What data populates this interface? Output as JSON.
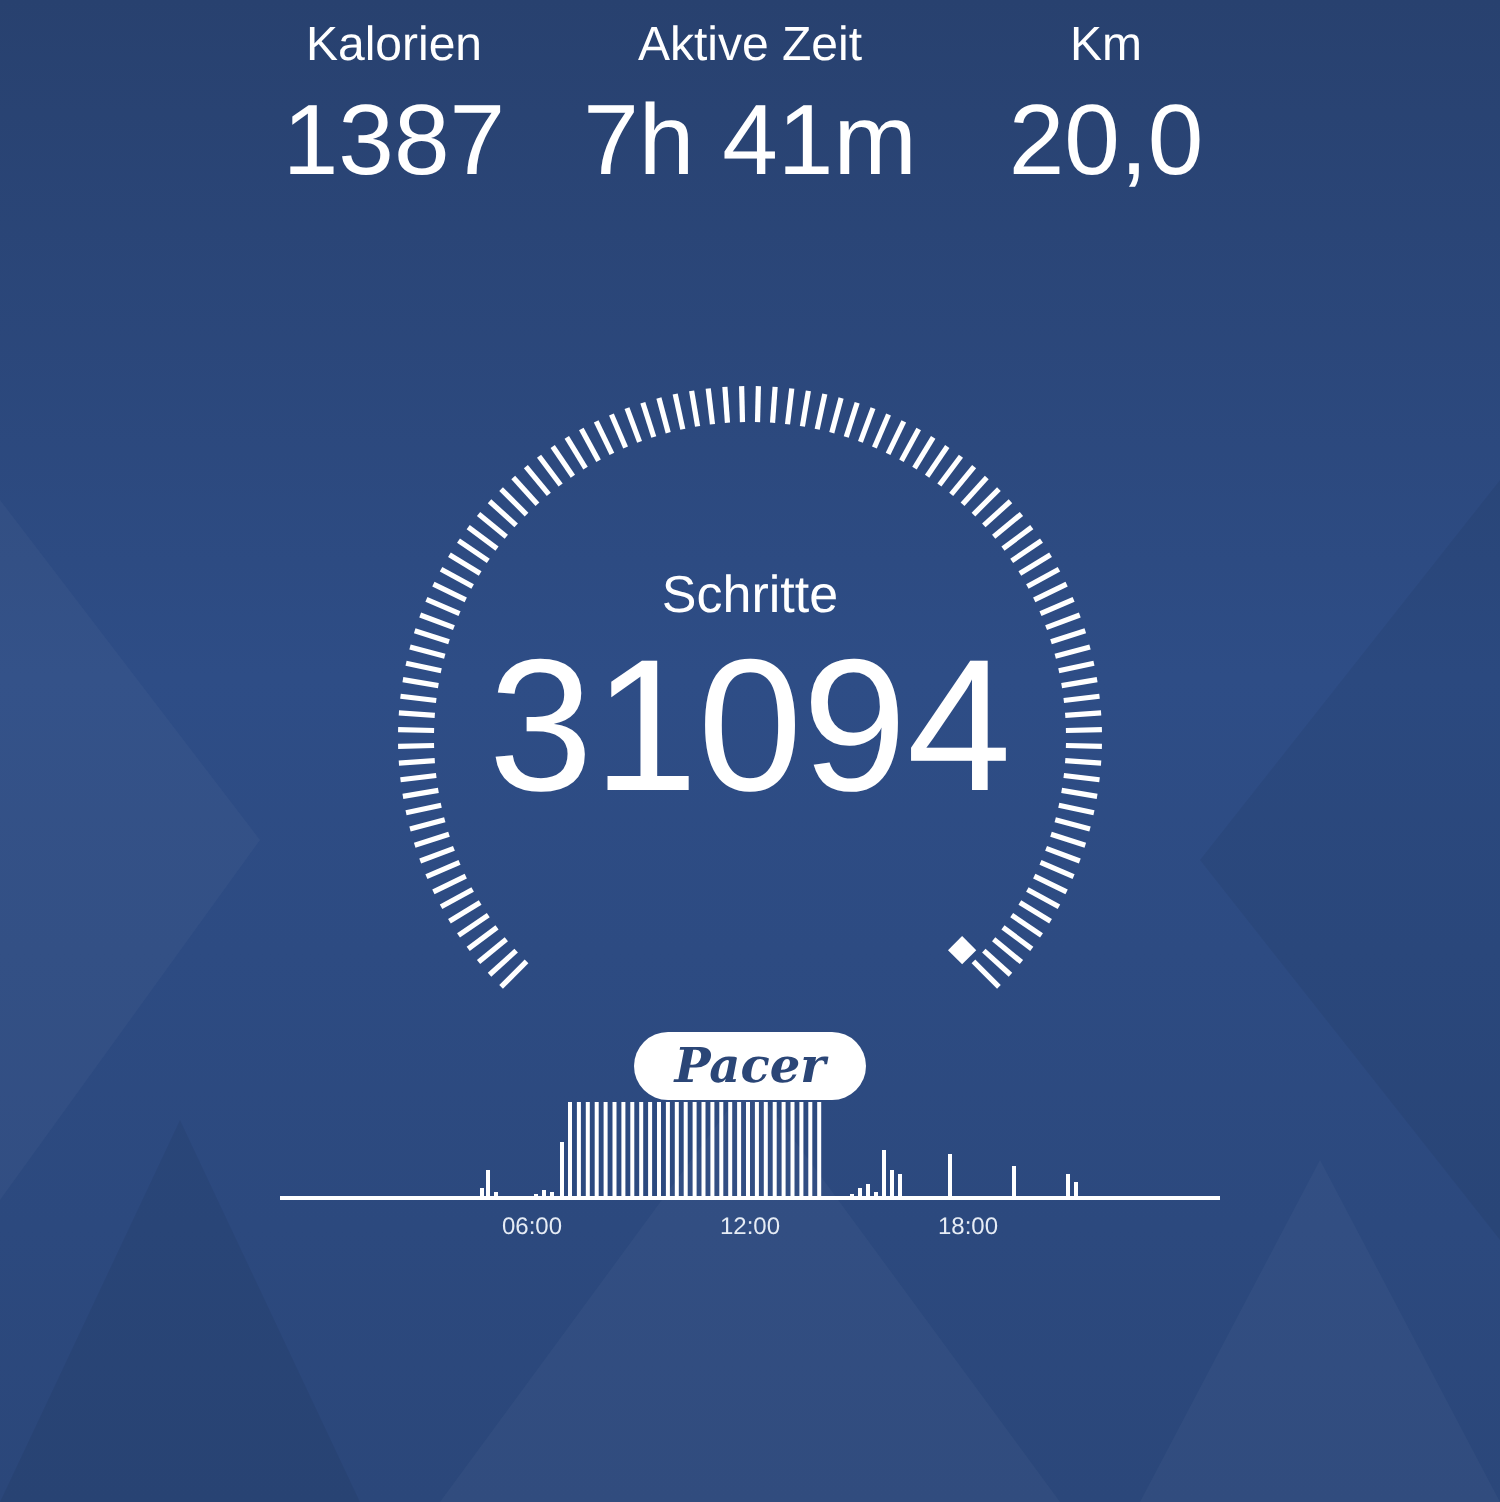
{
  "stats": [
    {
      "label": "Kalorien",
      "value": "1387"
    },
    {
      "label": "Aktive Zeit",
      "value": "7h 41m"
    },
    {
      "label": "Km",
      "value": "20,0"
    }
  ],
  "gauge": {
    "label": "Schritte",
    "value": "31094"
  },
  "logo": "Pacer",
  "activity": {
    "time_labels": [
      "06:00",
      "12:00",
      "18:00"
    ]
  }
}
